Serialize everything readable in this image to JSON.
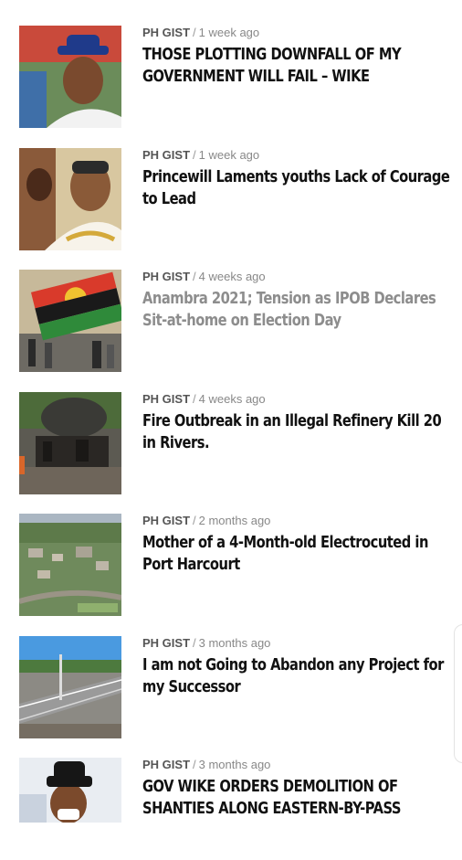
{
  "articles": [
    {
      "category": "PH GIST",
      "time": "1 week ago",
      "title": "THOSE PLOTTING DOWNFALL OF MY GOVERNMENT WILL FAIL – WIKE",
      "thumb_icon": "portrait-man-blue-hat"
    },
    {
      "category": "PH GIST",
      "time": "1 week ago",
      "title": "Princewill Laments youths Lack of Courage to Lead",
      "thumb_icon": "portrait-man-white-robe"
    },
    {
      "category": "PH GIST",
      "time": "4 weeks ago",
      "title": "Anambra 2021; Tension as IPOB Declares Sit-at-home on Election Day",
      "thumb_icon": "biafra-flag-crowd"
    },
    {
      "category": "PH GIST",
      "time": "4 weeks ago",
      "title": "Fire Outbreak in an Illegal Refinery Kill 20 in Rivers.",
      "thumb_icon": "burnt-refinery"
    },
    {
      "category": "PH GIST",
      "time": "2 months ago",
      "title": "Mother of a 4-Month-old Electrocuted in Port Harcourt",
      "thumb_icon": "aerial-town"
    },
    {
      "category": "PH GIST",
      "time": "3 months ago",
      "title": "I am not Going to Abandon any Project for my Successor",
      "thumb_icon": "road-flyover"
    },
    {
      "category": "PH GIST",
      "time": "3 months ago",
      "title": "GOV WIKE ORDERS DEMOLITION OF SHANTIES ALONG EASTERN-BY-PASS",
      "thumb_icon": "portrait-man-black-hat"
    }
  ]
}
